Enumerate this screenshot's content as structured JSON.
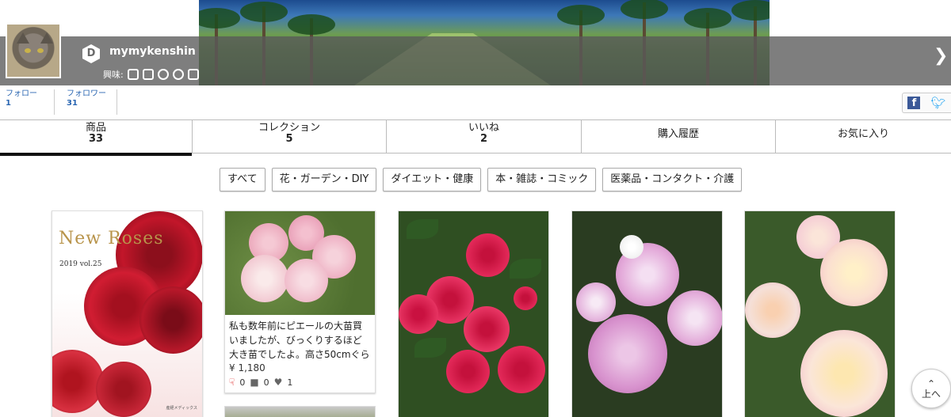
{
  "profile": {
    "username": "mymykenshin",
    "badge_letter": "D",
    "interests_label": "興味:",
    "interest_icons": [
      "book-icon",
      "cutlery-icon",
      "soccer-ball-icon",
      "gardening-icon",
      "bone-icon"
    ]
  },
  "follow": {
    "following_label": "フォロー",
    "following_count": "1",
    "followers_label": "フォロワー",
    "followers_count": "31"
  },
  "tabs": [
    {
      "label": "商品",
      "count": "33"
    },
    {
      "label": "コレクション",
      "count": "5"
    },
    {
      "label": "いいね",
      "count": "2"
    },
    {
      "label": "購入履歴"
    },
    {
      "label": "お気に入り"
    }
  ],
  "filters": [
    "すべて",
    "花・ガーデン・DIY",
    "ダイエット・健康",
    "本・雑誌・コミック",
    "医薬品・コンタクト・介護"
  ],
  "products": {
    "magazine_title": "New Roses",
    "magazine_issue": "2019  vol.25",
    "magazine_publisher": "産経メディックス",
    "item2_desc": "私も数年前にピエールの大苗買いましたが、びっくりするほど大き苗でしたよ。高さ50cmぐらい …",
    "item2_price": "¥ 1,180",
    "item2_likes": "0",
    "item2_comments": "0",
    "item2_hearts": "1"
  },
  "up_button": "上へ",
  "colors": {
    "link_blue": "#2a66b2",
    "active_tab": "#111111",
    "facebook": "#3b5998",
    "twitter": "#1da1f2"
  }
}
